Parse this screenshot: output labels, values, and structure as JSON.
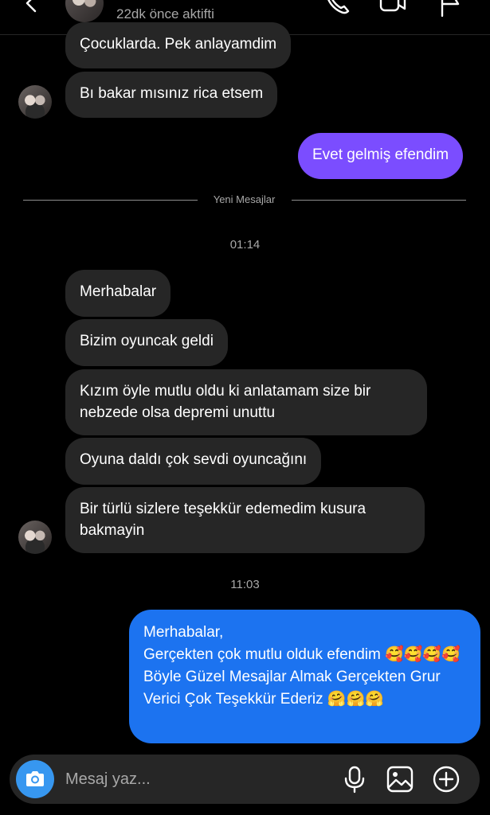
{
  "header": {
    "status": "22dk önce aktifti",
    "icons": [
      "back-icon",
      "phone-icon",
      "video-icon",
      "flag-icon"
    ]
  },
  "messages": {
    "m1": "Çocuklarda. Pek anlayamdim",
    "m2": "Bı bakar mısınız rica etsem",
    "m3": "Evet gelmiş efendim",
    "divider": "Yeni Mesajlar",
    "time1": "01:14",
    "m4": "Merhabalar",
    "m5": "Bizim oyuncak geldi",
    "m6": "Kızım öyle mutlu oldu ki anlatamam size bir nebzede olsa depremi unuttu",
    "m7": "Oyuna daldı çok sevdi oyuncağını",
    "m8": "Bir türlü sizlere teşekkür edemedim kusura bakmayin",
    "time2": "11:03",
    "m9_line1": "Merhabalar,",
    "m9_line2": "Gerçekten çok mutlu olduk efendim 🥰🥰🥰🥰",
    "m9_line3": "Böyle Güzel Mesajlar Almak Gerçekten Grur Verici Çok Teşekkür Ederiz 🤗🤗🤗"
  },
  "composer": {
    "placeholder": "Mesaj yaz...",
    "icons": [
      "camera-icon",
      "mic-icon",
      "gallery-icon",
      "plus-icon"
    ]
  },
  "colors": {
    "background": "#000000",
    "incoming_bubble": "#262626",
    "outgoing_purple": "#7b4dff",
    "outgoing_blue": "#1c73f0",
    "camera_button": "#3797f0",
    "muted_text": "#a8a8a8"
  }
}
